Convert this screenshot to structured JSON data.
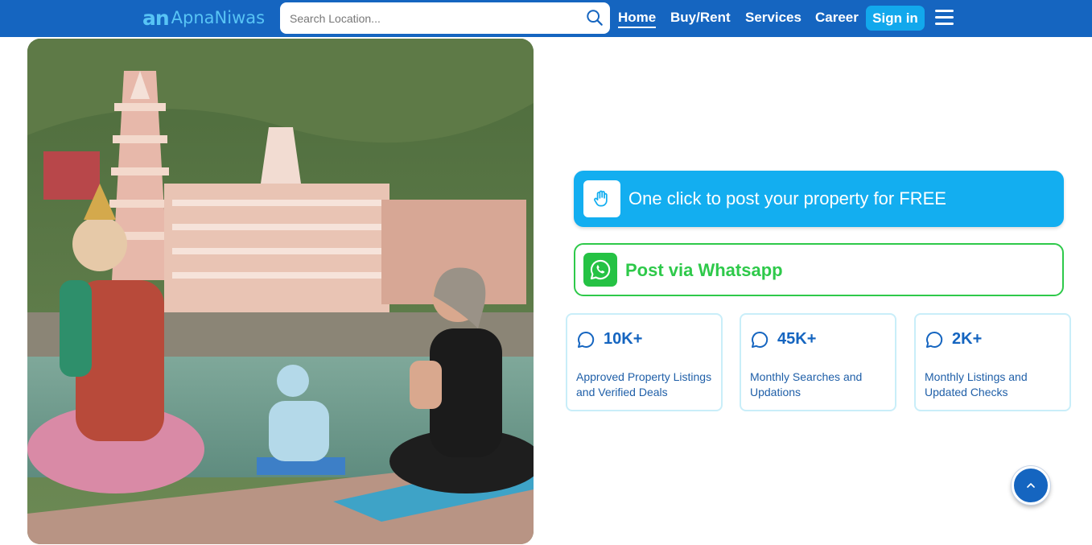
{
  "brand": {
    "logo_mark": "an",
    "logo_text": "ApnaNiwas",
    "primary_color": "#1565c0",
    "accent_color": "#13aef0",
    "whatsapp_color": "#2ec94a"
  },
  "search": {
    "placeholder": "Search Location...",
    "value": ""
  },
  "nav": {
    "items": [
      "Home",
      "Buy/Rent",
      "Services",
      "Career"
    ],
    "active": "Home",
    "signin_label": "Sign in"
  },
  "hero_image": {
    "alt": "Yoga by the river in Rishikesh"
  },
  "actions": {
    "post_label": "One click to post your property for FREE",
    "post_icon": "hand-icon",
    "whatsapp_label": "Post via Whatsapp",
    "whatsapp_icon": "whatsapp-icon"
  },
  "stats": [
    {
      "value": "10K+",
      "desc": "Approved Property Listings and Verified Deals"
    },
    {
      "value": "45K+",
      "desc": "Monthly Searches and Updations"
    },
    {
      "value": "2K+",
      "desc": "Monthly Listings and Updated Checks"
    }
  ],
  "icons": {
    "scroll_top": "chevron-up-icon",
    "menu": "hamburger-menu-icon",
    "search": "search-icon"
  }
}
